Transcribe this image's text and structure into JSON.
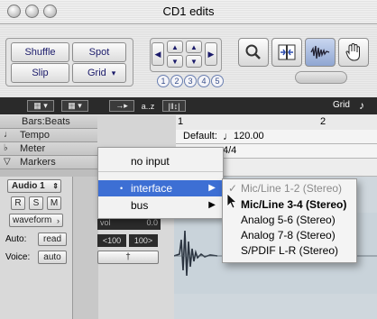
{
  "window": {
    "title": "CD1 edits"
  },
  "toolbar": {
    "shuffle": "Shuffle",
    "spot": "Spot",
    "slip": "Slip",
    "grid": "Grid",
    "grid_arrow": "▾",
    "zoom_numbers": [
      "1",
      "2",
      "3",
      "4",
      "5"
    ]
  },
  "darkbar": {
    "sort": "a..z",
    "grid_label": "Grid"
  },
  "rows": {
    "bars_beats": "Bars:Beats",
    "tempo": "Tempo",
    "meter": "Meter",
    "markers": "Markers"
  },
  "ruler": {
    "start": "1",
    "bar2": "2"
  },
  "tempo_default": {
    "label": "Default:",
    "value": "120.00"
  },
  "meter_value": "4/4",
  "track": {
    "name": "Audio 1",
    "r": "R",
    "s": "S",
    "m": "M",
    "view": "waveform",
    "auto_label": "Auto:",
    "auto_value": "read",
    "voice_label": "Voice:",
    "voice_value": "auto",
    "vol_label": "vol",
    "vol_value": "0.0",
    "pan_left": "<100",
    "pan_right": "100>"
  },
  "menu_input": {
    "items": [
      "no input",
      "interface",
      "bus"
    ],
    "selected": "interface"
  },
  "menu_interface": {
    "items": [
      "Mic/Line 1-2 (Stereo)",
      "Mic/Line 3-4 (Stereo)",
      "Analog 5-6 (Stereo)",
      "Analog 7-8 (Stereo)",
      "S/PDIF L-R (Stereo)"
    ],
    "checked": "Mic/Line 1-2 (Stereo)",
    "hovered": "Mic/Line 3-4 (Stereo)"
  }
}
